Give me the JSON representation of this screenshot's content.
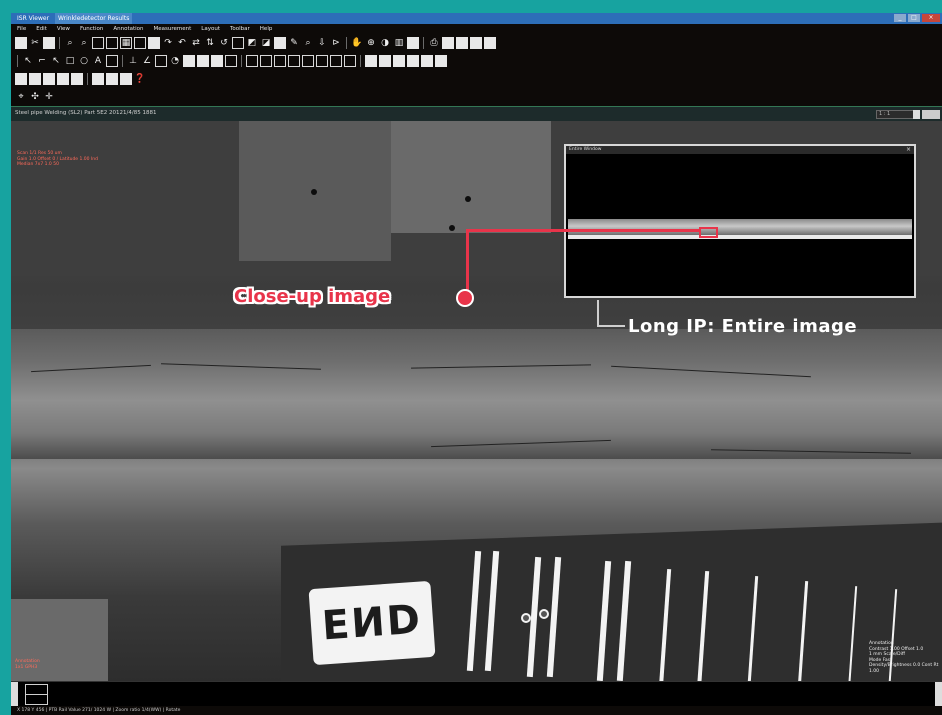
{
  "window": {
    "title": "ISR Viewer",
    "title_badge": "Wrinkledetector Results",
    "controls": [
      "_",
      "□",
      "×"
    ]
  },
  "menu": [
    "File",
    "Edit",
    "View",
    "Function",
    "Annotation",
    "Measurement",
    "Layout",
    "Toolbar",
    "Help"
  ],
  "statusstrip": {
    "path": "Steel pipe Welding (SL2) Part 5E2 20121/4/85 1881",
    "zoom": "1 : 1"
  },
  "overlay_topleft": [
    "Scan 1/1 Res 50 um",
    "Gain 1.0 Offset 0 / Latitude 1.00 Ind",
    "Median 7x7 1.0 50"
  ],
  "overlay_bottomleft": [
    "Annotation",
    "1x1 GPH3"
  ],
  "overlay_bottomright": [
    "Annotation",
    "Contrast 1.00 Offset 1.0",
    "1 mm Scale/Diff",
    "Mode Fast",
    "Density/Brightness 0.0 Cont Rt 1.00"
  ],
  "inset": {
    "title": "Entire Window",
    "close": "×"
  },
  "iqi_label": "EИD",
  "callouts": {
    "closeup": "Close-up image",
    "longip": "Long IP:  Entire image"
  },
  "statusbar": "X 178 Y 456 | PTB Rail Value 271/ 1024 W | Zoom ratio 1/4(WW) | Rotate"
}
